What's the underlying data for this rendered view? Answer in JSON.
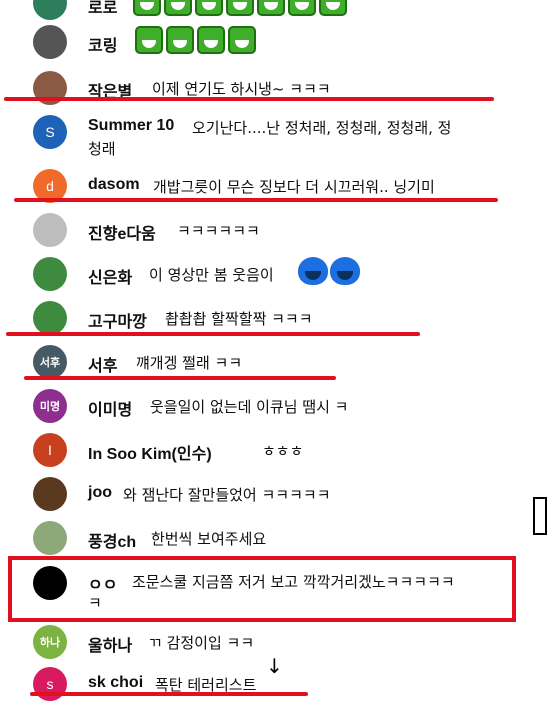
{
  "comments": [
    {
      "name": "로로",
      "text": "",
      "avatar_color": "#2e7d5b",
      "avatar_text": "ㅇ"
    },
    {
      "name": "코링",
      "text": "",
      "avatar_color": "#444444",
      "avatar_text": ""
    },
    {
      "name": "작은별",
      "text": "이제 연기도 하시냉~ ㅋㅋㅋ",
      "avatar_color": "#8a5a44",
      "avatar_text": ""
    },
    {
      "name": "Summer 10",
      "text": "오기난다....난 정처래, 정청래, 정청래, 정",
      "text2": "청래",
      "avatar_color": "#1e63b8",
      "avatar_text": "S"
    },
    {
      "name": "dasom",
      "text": "개밥그릇이 무슨 징보다 더 시끄러워.. 닝기미",
      "avatar_color": "#f06a2a",
      "avatar_text": "d"
    },
    {
      "name": "진향e다움",
      "text": "ㅋㅋㅋㅋㅋㅋ",
      "avatar_color": "#b7b7b7",
      "avatar_text": ""
    },
    {
      "name": "신은화",
      "text": "이 영상만 봄 웃음이",
      "avatar_color": "#3e8a3e",
      "avatar_text": ""
    },
    {
      "name": "고구마깡",
      "text": "촵촵촵 할짝할짝 ㅋㅋㅋ",
      "avatar_color": "#3e8a3e",
      "avatar_text": ""
    },
    {
      "name": "서후",
      "text": "꺠개겡 쩔래 ㅋㅋ",
      "avatar_color": "#455a64",
      "avatar_text": "서후"
    },
    {
      "name": "이미명",
      "text": "웃을일이 없는데 이큐님 땜시 ㅋ",
      "avatar_color": "#8e2f8f",
      "avatar_text": "미명"
    },
    {
      "name": "In Soo Kim(인수)",
      "text": "ㅎㅎㅎ",
      "avatar_color": "#c8401e",
      "avatar_text": "I"
    },
    {
      "name": "joo",
      "text": "와 잼난다 잘만들었어 ㅋㅋㅋㅋㅋ",
      "avatar_color": "#5a3a1e",
      "avatar_text": ""
    },
    {
      "name": "풍경ch",
      "text": "한번씩 보여주세요",
      "avatar_color": "#8ea87a",
      "avatar_text": ""
    },
    {
      "name": "ㅇㅇ",
      "text": "조문스쿨 지금쯤 저거 보고 깍깍거리겠노ㅋㅋㅋㅋㅋ",
      "text2": "ㅋ",
      "avatar_color": "#000000",
      "avatar_text": ""
    },
    {
      "name": "울하나",
      "text": "ㄲ 감정이입 ㅋㅋ",
      "avatar_color": "#7cb342",
      "avatar_text": "하나"
    },
    {
      "name": "sk choi",
      "text": "폭탄 테러리스트",
      "avatar_color": "#d81b60",
      "avatar_text": "s"
    }
  ]
}
